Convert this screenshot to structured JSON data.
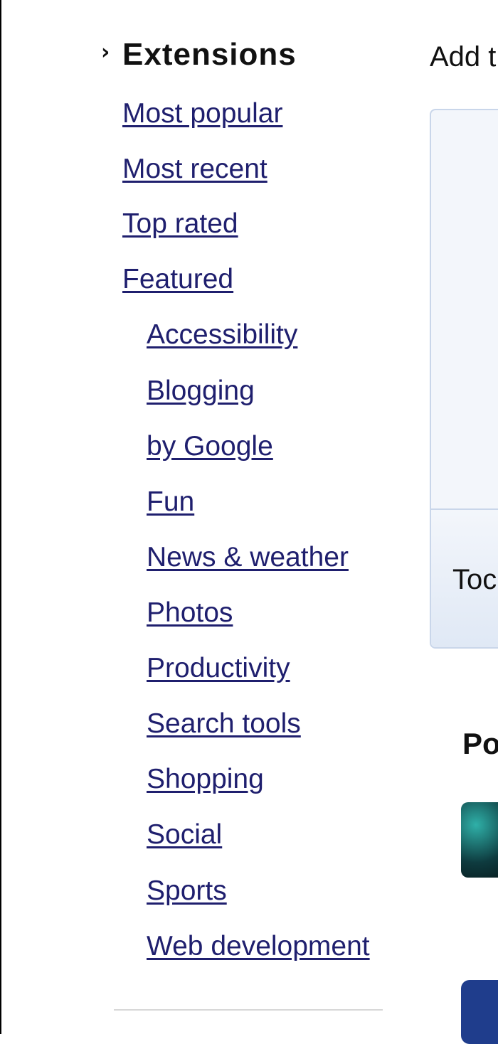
{
  "sidebar": {
    "section_title": "Extensions",
    "section_arrow": "›",
    "links": [
      {
        "label": "Most popular"
      },
      {
        "label": "Most recent"
      },
      {
        "label": "Top rated"
      },
      {
        "label": "Featured"
      }
    ],
    "categories": [
      {
        "label": "Accessibility"
      },
      {
        "label": "Blogging"
      },
      {
        "label": "by Google"
      },
      {
        "label": "Fun"
      },
      {
        "label": "News & weather"
      },
      {
        "label": "Photos"
      },
      {
        "label": "Productivity"
      },
      {
        "label": "Search tools"
      },
      {
        "label": "Shopping"
      },
      {
        "label": "Social"
      },
      {
        "label": "Sports"
      },
      {
        "label": "Web development"
      }
    ]
  },
  "main": {
    "add_text": "Add t",
    "panel_text": "Toc",
    "popular_heading": "Po"
  }
}
